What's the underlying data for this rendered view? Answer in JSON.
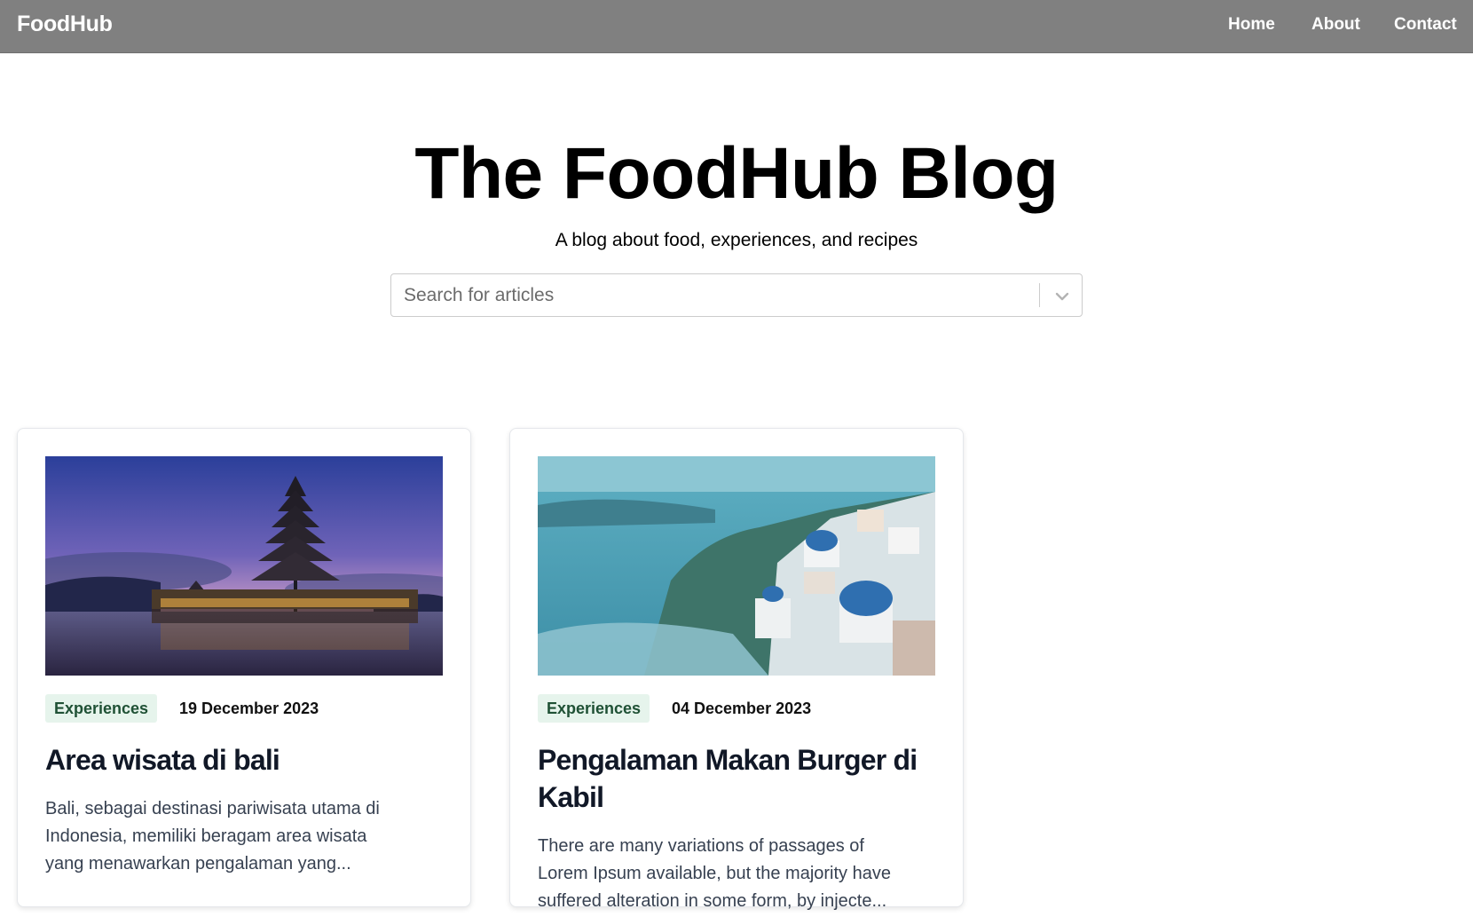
{
  "navbar": {
    "brand": "FoodHub",
    "links": [
      "Home",
      "About",
      "Contact"
    ]
  },
  "hero": {
    "title": "The FoodHub Blog",
    "subtitle": "A blog about food, experiences, and recipes"
  },
  "search": {
    "placeholder": "Search for articles",
    "value": ""
  },
  "colors": {
    "navbar_bg": "#808080",
    "tag_bg": "#e6f4ec",
    "tag_text": "#1f5135"
  },
  "articles": [
    {
      "image": "bali-temple-lake-photo",
      "category": "Experiences",
      "date": "19 December 2023",
      "title": "Area wisata di bali",
      "excerpt_lines": [
        "Bali, sebagai destinasi pariwisata utama di",
        "Indonesia, memiliki beragam area wisata",
        "yang menawarkan pengalaman yang..."
      ]
    },
    {
      "image": "santorini-village-photo",
      "category": "Experiences",
      "date": "04 December 2023",
      "title": "Pengalaman Makan Burger di Kabil",
      "excerpt_lines": [
        "There are many variations of passages of",
        "Lorem Ipsum available, but the majority have",
        "suffered alteration in some form, by injecte..."
      ]
    }
  ]
}
